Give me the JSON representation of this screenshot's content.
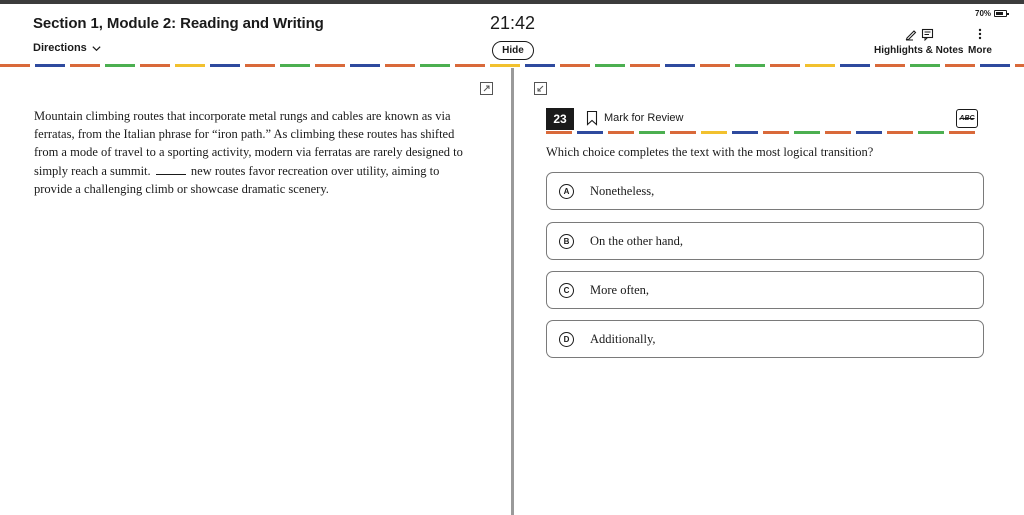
{
  "header": {
    "section_title": "Section 1, Module 2: Reading and Writing",
    "directions_label": "Directions",
    "timer": "21:42",
    "hide_label": "Hide",
    "battery": "70%",
    "highlights_label": "Highlights & Notes",
    "more_label": "More"
  },
  "passage": {
    "text_before_blank": "Mountain climbing routes that incorporate metal rungs and cables are known as via ferratas, from the Italian phrase for “iron path.” As climbing these routes has shifted from a mode of travel to a sporting activity, modern via ferratas are rarely designed to simply reach a summit.",
    "text_after_blank": "new routes favor recreation over utility, aiming to provide a challenging climb or showcase dramatic scenery."
  },
  "question": {
    "number": "23",
    "mark_for_review_label": "Mark for Review",
    "abc_label": "ABC",
    "prompt": "Which choice completes the text with the most logical transition?",
    "choices": [
      {
        "letter": "A",
        "text": "Nonetheless,"
      },
      {
        "letter": "B",
        "text": "On the other hand,"
      },
      {
        "letter": "C",
        "text": "More often,"
      },
      {
        "letter": "D",
        "text": "Additionally,"
      }
    ]
  },
  "colors": {
    "rule_blue": "#2e4a9e",
    "rule_orange": "#d9693a",
    "rule_green": "#4caf50",
    "rule_yellow": "#f2c12e",
    "qnum_bg": "#1a1a1a",
    "divider": "#9a9a9a"
  }
}
